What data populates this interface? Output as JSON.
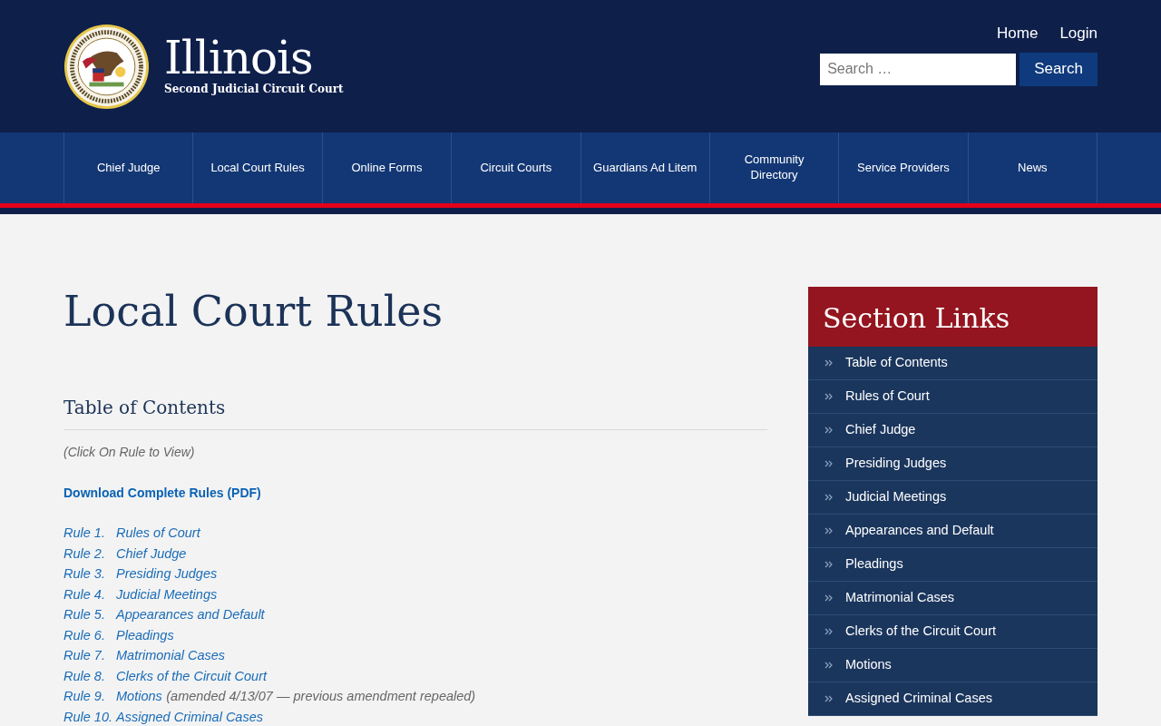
{
  "header": {
    "site_title": "Illinois",
    "site_subtitle": "Second Judicial Circuit Court",
    "top_links": [
      "Home",
      "Login"
    ],
    "search": {
      "placeholder": "Search …",
      "button": "Search"
    }
  },
  "nav": [
    "Chief Judge",
    "Local Court Rules",
    "Online Forms",
    "Circuit Courts",
    "Guardians Ad Litem",
    "Community Directory",
    "Service Providers",
    "News"
  ],
  "page_title": "Local Court Rules",
  "section_heading": "Table of Contents",
  "instruction": "(Click On Rule to View)",
  "download_link": "Download Complete Rules (PDF)",
  "rules": [
    {
      "number": "Rule 1.",
      "title": "Rules of Court"
    },
    {
      "number": "Rule 2.",
      "title": "Chief Judge"
    },
    {
      "number": "Rule 3.",
      "title": "Presiding Judges"
    },
    {
      "number": "Rule 4.",
      "title": "Judicial Meetings"
    },
    {
      "number": "Rule 5.",
      "title": "Appearances and Default"
    },
    {
      "number": "Rule 6.",
      "title": "Pleadings"
    },
    {
      "number": "Rule 7.",
      "title": "Matrimonial Cases"
    },
    {
      "number": "Rule 8.",
      "title": "Clerks of the Circuit Court"
    },
    {
      "number": "Rule 9.",
      "title": "Motions",
      "note": "(amended 4/13/07 — previous amendment repealed)"
    },
    {
      "number": "Rule 10.",
      "title": "Assigned Criminal Cases"
    }
  ],
  "sidebar": {
    "title": "Section Links",
    "items": [
      "Table of Contents",
      "Rules of Court",
      "Chief Judge",
      "Presiding Judges",
      "Judicial Meetings",
      "Appearances and Default",
      "Pleadings",
      "Matrimonial Cases",
      "Clerks of the Circuit Court",
      "Motions",
      "Assigned Criminal Cases"
    ]
  }
}
